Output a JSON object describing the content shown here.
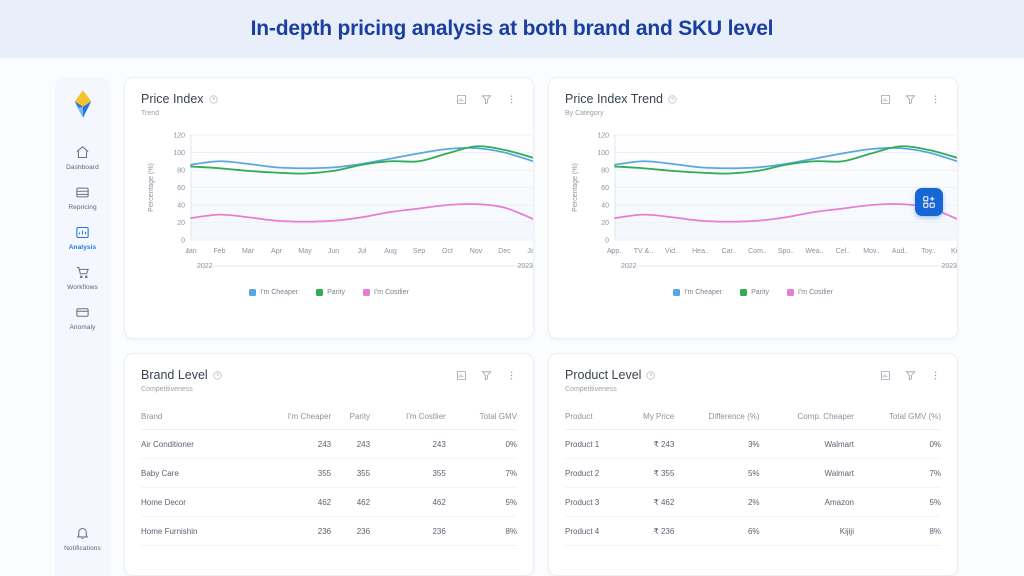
{
  "banner": {
    "title": "In-depth pricing analysis at both brand and SKU level",
    "bg": "#e8effb",
    "color": "#1a3fa0"
  },
  "sidebar": {
    "logo_name": "brand-logo",
    "items": [
      {
        "label": "Dashboard",
        "icon": "home-icon",
        "active": false
      },
      {
        "label": "Repricing",
        "icon": "tag-icon",
        "active": false
      },
      {
        "label": "Analysis",
        "icon": "analysis-chart-icon",
        "active": true
      },
      {
        "label": "Workflows",
        "icon": "cart-icon",
        "active": false
      },
      {
        "label": "Anomaly",
        "icon": "card-icon",
        "active": false
      }
    ],
    "bottom": {
      "label": "Notifications",
      "icon": "bell-icon"
    }
  },
  "fab": {
    "name": "widget-grid-button",
    "icon": "grid-widget-icon",
    "color": "#1766d6"
  },
  "card_actions": [
    {
      "name": "export-chart-icon",
      "label": "Export"
    },
    {
      "name": "filter-icon",
      "label": "Filter"
    },
    {
      "name": "more-options-icon",
      "label": "More"
    }
  ],
  "cards": {
    "price_index": {
      "title": "Price Index",
      "subtitle": "Trend"
    },
    "price_index_trend": {
      "title": "Price Index Trend",
      "subtitle": "By Category"
    },
    "brand_level": {
      "title": "Brand Level",
      "subtitle": "Competitiveness"
    },
    "product_level": {
      "title": "Product Level",
      "subtitle": "Competitiveness"
    }
  },
  "legend": [
    {
      "label": "I'm Cheaper",
      "color": "#5BA7E0"
    },
    {
      "label": "Parity",
      "color": "#2FAE56"
    },
    {
      "label": "I'm Costlier",
      "color": "#E87DD4"
    }
  ],
  "chart_data": [
    {
      "id": "price-index-trend-months",
      "type": "line",
      "title": "Price Index",
      "subtitle": "Trend",
      "xlabel": "",
      "ylabel": "Percentage (%)",
      "ylim": [
        0,
        120
      ],
      "yticks": [
        0,
        20,
        40,
        60,
        80,
        100,
        120
      ],
      "grid": true,
      "legend_position": "bottom",
      "range_start_label": "2022",
      "range_end_label": "2023",
      "categories": [
        "Jan",
        "Feb",
        "Mar",
        "Apr",
        "May",
        "Jun",
        "Jul",
        "Aug",
        "Sep",
        "Oct",
        "Nov",
        "Dec",
        "Jan"
      ],
      "series": [
        {
          "name": "I'm Cheaper",
          "color": "#5BA7E0",
          "values": [
            86,
            90,
            87,
            83,
            82,
            83,
            87,
            93,
            99,
            104,
            105,
            100,
            90
          ]
        },
        {
          "name": "Parity",
          "color": "#2FAE56",
          "values": [
            84,
            82,
            79,
            77,
            76,
            79,
            86,
            90,
            90,
            99,
            107,
            103,
            94
          ]
        },
        {
          "name": "I'm Costlier",
          "color": "#E87DD4",
          "values": [
            25,
            29,
            26,
            22,
            21,
            22,
            26,
            32,
            36,
            40,
            41,
            37,
            24
          ]
        }
      ]
    },
    {
      "id": "price-index-trend-categories",
      "type": "line",
      "title": "Price Index Trend",
      "subtitle": "By Category",
      "xlabel": "",
      "ylabel": "Percentage (%)",
      "ylim": [
        0,
        120
      ],
      "yticks": [
        0,
        20,
        40,
        60,
        80,
        100,
        120
      ],
      "grid": true,
      "legend_position": "bottom",
      "range_start_label": "2022",
      "range_end_label": "2023",
      "categories": [
        "App..",
        "TV &..",
        "Vid..",
        "Hea..",
        "Car..",
        "Com..",
        "Spo..",
        "Wea..",
        "Cel..",
        "Mov..",
        "Aud..",
        "Toy..",
        "Kit.."
      ],
      "series": [
        {
          "name": "I'm Cheaper",
          "color": "#5BA7E0",
          "values": [
            86,
            90,
            87,
            83,
            82,
            83,
            87,
            93,
            99,
            104,
            105,
            100,
            90
          ]
        },
        {
          "name": "Parity",
          "color": "#2FAE56",
          "values": [
            84,
            82,
            79,
            77,
            76,
            79,
            86,
            90,
            90,
            99,
            107,
            103,
            94
          ]
        },
        {
          "name": "I'm Costlier",
          "color": "#E87DD4",
          "values": [
            25,
            29,
            26,
            22,
            21,
            22,
            26,
            32,
            36,
            40,
            41,
            37,
            24
          ]
        }
      ]
    }
  ],
  "brand_table": {
    "columns": [
      "Brand",
      "I'm Cheaper",
      "Parity",
      "I'm Costlier",
      "Total GMV"
    ],
    "rows": [
      [
        "Air Conditioner",
        "243",
        "243",
        "243",
        "0%"
      ],
      [
        "Baby Care",
        "355",
        "355",
        "355",
        "7%"
      ],
      [
        "Home Decor",
        "462",
        "462",
        "462",
        "5%"
      ],
      [
        "Home Furnishin",
        "236",
        "236",
        "236",
        "8%"
      ]
    ]
  },
  "product_table": {
    "columns": [
      "Product",
      "My Price",
      "Difference (%)",
      "Comp. Cheaper",
      "Total GMV (%)"
    ],
    "rows": [
      [
        "Product 1",
        "₹ 243",
        "3%",
        "Walmart",
        "0%"
      ],
      [
        "Product 2",
        "₹ 355",
        "5%",
        "Walmart",
        "7%"
      ],
      [
        "Product 3",
        "₹ 462",
        "2%",
        "Amazon",
        "5%"
      ],
      [
        "Product 4",
        "₹ 236",
        "6%",
        "Kijiji",
        "8%"
      ]
    ]
  }
}
